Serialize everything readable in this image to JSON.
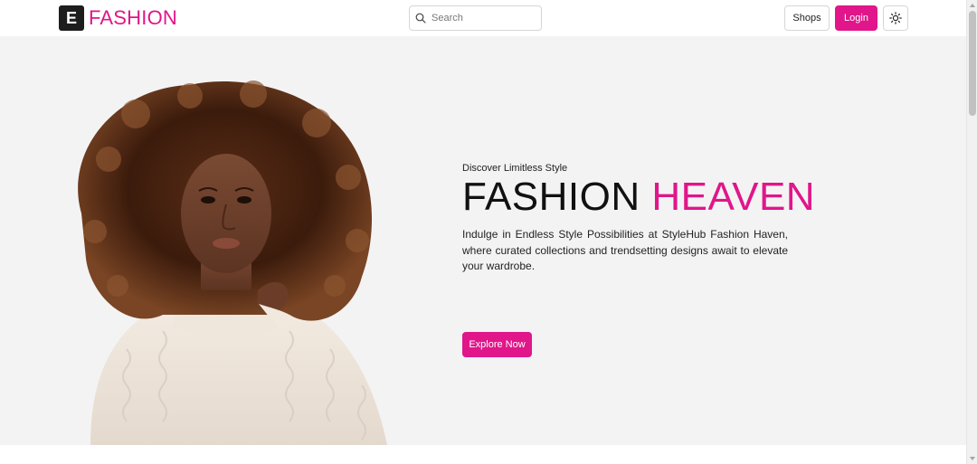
{
  "header": {
    "logo_mark": "E",
    "logo_text": "FASHION",
    "search_placeholder": "Search",
    "shops_label": "Shops",
    "login_label": "Login"
  },
  "hero": {
    "kicker": "Discover Limitless Style",
    "headline_dark": "FASHION",
    "headline_accent": "HEAVEN",
    "description": "Indulge in Endless Style Possibilities at StyleHub Fashion Haven, where curated collections and trendsetting designs await to elevate your wardrobe.",
    "cta_label": "Explore Now",
    "image_subject": "model-portrait"
  },
  "icons": {
    "search": "search-icon",
    "theme": "sun-icon",
    "scroll_up": "caret-up-icon",
    "scroll_down": "caret-down-icon"
  },
  "colors": {
    "accent": "#e0168a",
    "dark": "#1d1d1d",
    "hero_bg": "#f3f3f4"
  }
}
